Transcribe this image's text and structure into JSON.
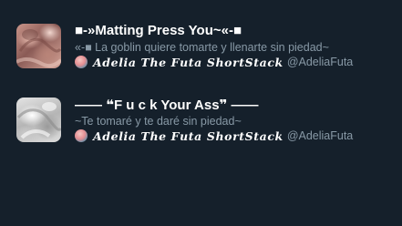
{
  "colors": {
    "background": "#15202b",
    "title": "#ffffff",
    "secondary_text": "#8899a6"
  },
  "lists": [
    {
      "title": "■-»Matting Press You~«-■",
      "description": "«-■ La goblin quiere tomarte y llenarte sin piedad~",
      "author_display_name": "𝑨𝒅𝒆𝒍𝒊𝒂 𝑻𝒉𝒆 𝑭𝒖𝒕𝒂 𝑺𝒉𝒐𝒓𝒕𝑺𝒕𝒂𝒄𝒌",
      "author_handle": "@AdeliaFuta"
    },
    {
      "title": "—— ❝F u c k Your Ass❞ ——",
      "description": "~Te tomaré y te daré sin piedad~",
      "author_display_name": "𝑨𝒅𝒆𝒍𝒊𝒂 𝑻𝒉𝒆 𝑭𝒖𝒕𝒂 𝑺𝒉𝒐𝒓𝒕𝑺𝒕𝒂𝒄𝒌",
      "author_handle": "@AdeliaFuta"
    }
  ]
}
